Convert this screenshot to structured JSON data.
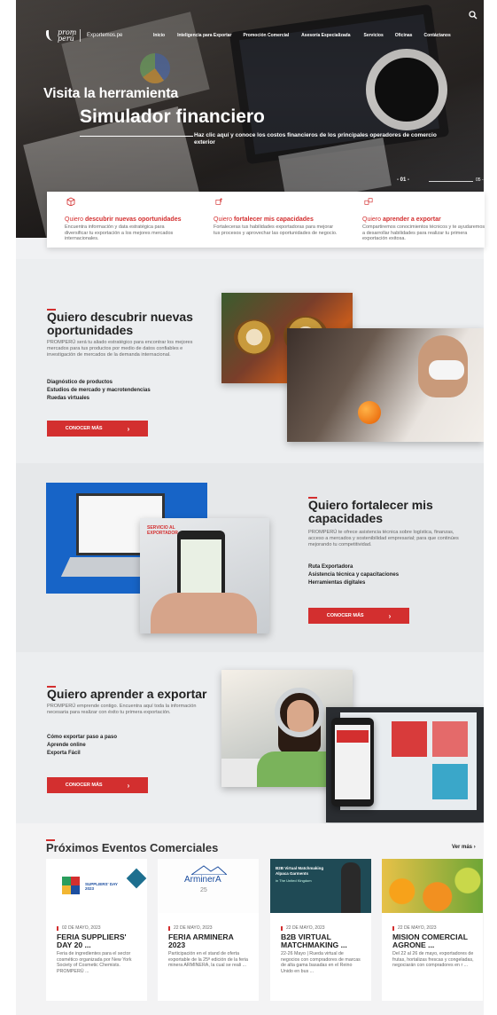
{
  "nav": {
    "logo_text": "prom perú",
    "exportemos": "Exportemos.pe",
    "menu": [
      "Inicio",
      "Inteligencia para Exportar",
      "Promoción Comercial",
      "Asesoría Especializada",
      "Servicios",
      "Oficinas",
      "Contáctanos"
    ]
  },
  "hero": {
    "pretitle": "Visita la herramienta",
    "title": "Simulador financiero",
    "subtitle": "Haz clic aquí y conoce los costos financieros de los principales operadores de comercio exterior",
    "slide_current": "- 01 -",
    "slide_total": "05 -"
  },
  "quick_cards": [
    {
      "pre": "Quiero ",
      "bold": "descubrir nuevas oportunidades",
      "desc": "Encuentra información y data estratégica para diversificar tu exportación a los mejores mercados internacionales."
    },
    {
      "pre": "Quiero ",
      "bold": "fortalecer mis capacidades",
      "desc": "Fortaleceras tus habilidades exportadoras para mejorar tus procesos y aprovechar las oportunidades de negocio."
    },
    {
      "pre": "Quiero ",
      "bold": "aprender a exportar",
      "desc": "Compartiremos conocimientos técnicos y te ayudaremos a desarrollar habilidades para realizar tu primera exportación exitosa."
    }
  ],
  "section1": {
    "title": "Quiero descubrir nuevas oportunidades",
    "desc": "PROMPERÚ será tu aliado estratégico para encontrar los mejores mercados para tus productos por medio de datos confiables e investigación de mercados de la demanda internacional.",
    "links": [
      "Diagnóstico de productos",
      "Estudios de mercado y macrotendencias",
      "Ruedas virtuales"
    ],
    "button": "CONOCER MÁS"
  },
  "section2": {
    "title": "Quiero fortalecer mis capacidades",
    "desc": "PROMPERÚ te ofrece asistencia técnica sobre logística, finanzas, acceso a mercados y sostenibilidad empresarial; para que continúes mejorando tu competitividad.",
    "links": [
      "Ruta Exportadora",
      "Asistencia técnica y capacitaciones",
      "Herramientas digitales"
    ],
    "button": "CONOCER MÁS",
    "phone_label": "SERVICIO AL EXPORTADOR"
  },
  "section3": {
    "title": "Quiero aprender a exportar",
    "desc": "PROMPERÚ emprende contigo. Encuentra aquí toda la información necesaria para realizar con éxito tu primera exportación.",
    "links": [
      "Cómo exportar paso a paso",
      "Aprende online",
      "Exporta Fácil"
    ],
    "button": "CONOCER MÁS"
  },
  "events": {
    "title": "Próximos Eventos Comerciales",
    "see_more": "Ver más",
    "items": [
      {
        "date": "02 DE MAYO, 2023",
        "title": "FERIA SUPPLIERS' DAY 20 ...",
        "desc": "Feria de ingredientes para el sector cosmético organizada por New York Society of Cosmetic Chemists. PROMPERÚ ...",
        "img_label": "SUPPLIERS' DAY 2023"
      },
      {
        "date": "22 DE MAYO, 2023",
        "title": "FERIA ARMINERA 2023",
        "desc": "Participación en el stand de oferta exportable de la 25ª edición de la feria minera ARMINERA, la cual se reali ...",
        "img_label": "ArminerA",
        "img_sub": "25"
      },
      {
        "date": "22 DE MAYO, 2023",
        "title": "B2B VIRTUAL MATCHMAKING ...",
        "desc": "22-26 Mayo | Rueda virtual de negocios con compradores de marcas de alta gama basadas en el Reino Unido en bus ...",
        "img_label": "B2B Virtual Matchmaking Alpaca Garments",
        "img_sub": "in The United Kingdom"
      },
      {
        "date": "22 DE MAYO, 2023",
        "title": "MISION COMERCIAL AGRONE ...",
        "desc": "Del 22 al 26 de mayo, exportadores de frutas, hortalizas frescas y congeladas, negociarán con compradores en r ..."
      }
    ]
  },
  "colors": {
    "accent": "#d32f2f",
    "hero_overlay": "#2c2826"
  }
}
